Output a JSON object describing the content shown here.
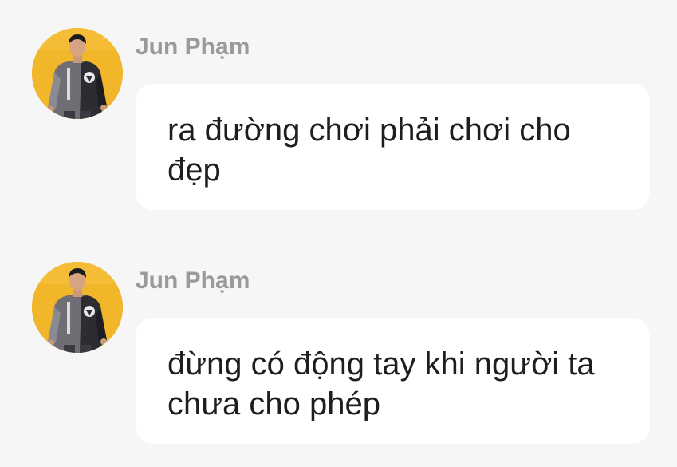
{
  "messages": [
    {
      "sender": "Jun Phạm",
      "avatar_icon": "user-avatar-photo",
      "text": "ra đường chơi phải chơi cho đẹp"
    },
    {
      "sender": "Jun Phạm",
      "avatar_icon": "user-avatar-photo",
      "text": "đừng có động tay khi người ta chưa cho phép"
    }
  ],
  "colors": {
    "background": "#f6f6f6",
    "bubble": "#ffffff",
    "sender_name": "#9a9a9a",
    "message_text": "#1e1e1e",
    "avatar_background": "#f1b629"
  }
}
